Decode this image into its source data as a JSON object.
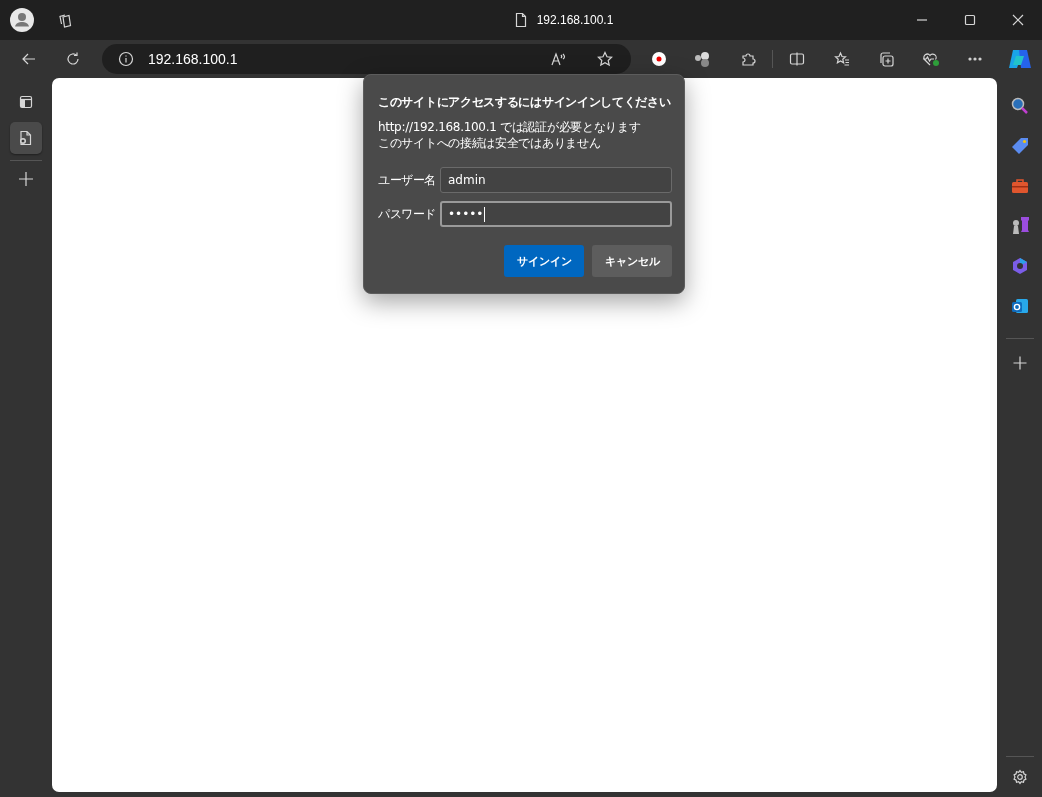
{
  "window": {
    "title": "192.168.100.1"
  },
  "address_bar": {
    "url": "192.168.100.1"
  },
  "vertical_tabs": [
    {
      "selected": true
    }
  ],
  "dialog": {
    "title": "このサイトにアクセスするにはサインインしてください",
    "message": [
      "http://192.168.100.1 では認証が必要となります",
      "このサイトへの接続は安全ではありません"
    ],
    "fields": [
      {
        "label": "ユーザー名",
        "value": "admin",
        "focused": false
      },
      {
        "label": "パスワード",
        "value": "•••••",
        "focused": true
      }
    ],
    "buttons": [
      {
        "label": "サインイン",
        "kind": "primary"
      },
      {
        "label": "キャンセル",
        "kind": "secondary"
      }
    ]
  }
}
